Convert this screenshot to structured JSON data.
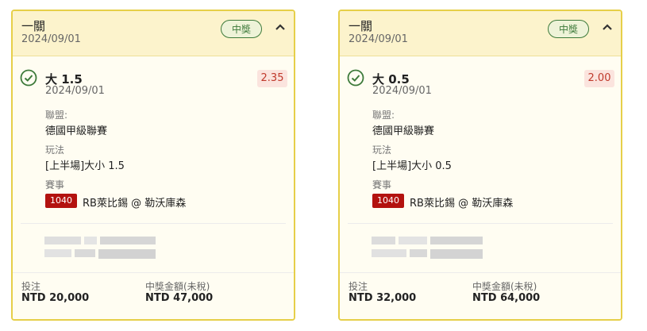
{
  "cards": [
    {
      "header": {
        "title": "一關",
        "date": "2024/09/01",
        "badge": "中獎"
      },
      "bet": {
        "title": "大 1.5",
        "date": "2024/09/01",
        "odds": "2.35",
        "league_label": "聯盟:",
        "league": "德國甲級聯賽",
        "play_label": "玩法",
        "play": "[上半場]大小 1.5",
        "event_label": "賽事",
        "event_id": "1040",
        "event_name": "RB萊比錫 @ 勒沃庫森"
      },
      "footer": {
        "stake_label": "投注",
        "stake": "NTD 20,000",
        "payout_label": "中獎金額(未稅)",
        "payout": "NTD 47,000"
      }
    },
    {
      "header": {
        "title": "一關",
        "date": "2024/09/01",
        "badge": "中獎"
      },
      "bet": {
        "title": "大 0.5",
        "date": "2024/09/01",
        "odds": "2.00",
        "league_label": "聯盟:",
        "league": "德國甲級聯賽",
        "play_label": "玩法",
        "play": "[上半場]大小 0.5",
        "event_label": "賽事",
        "event_id": "1040",
        "event_name": "RB萊比錫 @ 勒沃庫森"
      },
      "footer": {
        "stake_label": "投注",
        "stake": "NTD 32,000",
        "payout_label": "中獎金額(未稅)",
        "payout": "NTD 64,000"
      }
    }
  ],
  "colors": {
    "border": "#e6cf49",
    "header_bg": "#fcf3cc",
    "win_green": "#3d7a3a",
    "odds_red": "#c0392b",
    "event_badge": "#b3120f"
  },
  "icons": {
    "win": "check-circle-icon",
    "collapse": "chevron-up-icon"
  }
}
